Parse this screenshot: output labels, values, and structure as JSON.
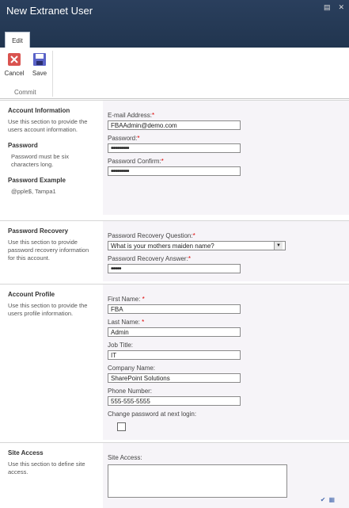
{
  "window": {
    "title": "New Extranet User"
  },
  "ribbon": {
    "tab": "Edit",
    "cancel_label": "Cancel",
    "save_label": "Save",
    "group_label": "Commit"
  },
  "sections": {
    "account": {
      "title": "Account Information",
      "desc": "Use this section to provide the users account information.",
      "password_heading": "Password",
      "password_desc": "Password must be six characters long.",
      "example_heading": "Password Example",
      "example_value": "@pple$, Tampa1",
      "email_label": "E-mail Address:",
      "email_value": "FBAAdmin@demo.com",
      "password_label": "Password:",
      "password_value": "•••••••••",
      "confirm_label": "Password Confirm:",
      "confirm_value": "•••••••••"
    },
    "recovery": {
      "title": "Password Recovery",
      "desc": "Use this section to provide password recovery information for this account.",
      "question_label": "Password Recovery Question:",
      "question_value": "What is your mothers maiden name?",
      "answer_label": "Password Recovery Answer:",
      "answer_value": "•••••"
    },
    "profile": {
      "title": "Account Profile",
      "desc": "Use this section to provide the users profile information.",
      "first_label": "First Name:",
      "first_value": "FBA",
      "last_label": "Last Name:",
      "last_value": "Admin",
      "job_label": "Job Title:",
      "job_value": "IT",
      "company_label": "Company Name:",
      "company_value": "SharePoint Solutions",
      "phone_label": "Phone Number:",
      "phone_value": "555-555-5555",
      "change_label": "Change password at next login:"
    },
    "site": {
      "title": "Site Access",
      "desc": "Use this section to define site access.",
      "access_label": "Site Access:"
    }
  },
  "icons": {
    "cancel": "cancel-icon",
    "save": "save-icon",
    "check_names": "check-names-icon",
    "browse": "address-book-icon"
  },
  "colors": {
    "title_bar": "#21354f",
    "required": "#dd0000",
    "section_bg": "#f6f4f8"
  }
}
